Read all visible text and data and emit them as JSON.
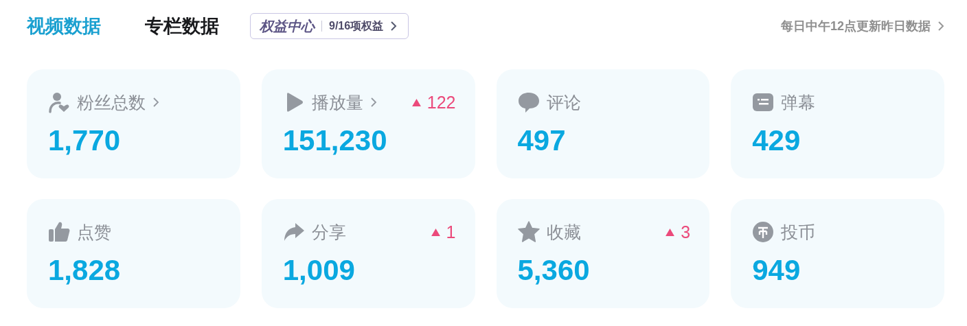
{
  "tabs": [
    {
      "label": "视频数据",
      "selected": true
    },
    {
      "label": "专栏数据",
      "selected": false
    }
  ],
  "benefits": {
    "title": "权益中心",
    "count": "9/16项权益"
  },
  "update_note": "每日中午12点更新昨日数据",
  "stats": [
    {
      "kind": "fans",
      "label": "粉丝总数",
      "link": true,
      "value": "1,770"
    },
    {
      "kind": "play",
      "label": "播放量",
      "link": true,
      "value": "151,230",
      "increase": "122"
    },
    {
      "kind": "comment",
      "label": "评论",
      "link": false,
      "value": "497"
    },
    {
      "kind": "danmaku",
      "label": "弹幕",
      "link": false,
      "value": "429"
    },
    {
      "kind": "like",
      "label": "点赞",
      "link": false,
      "value": "1,828"
    },
    {
      "kind": "share",
      "label": "分享",
      "link": false,
      "value": "1,009",
      "increase": "1"
    },
    {
      "kind": "favorite",
      "label": "收藏",
      "link": false,
      "value": "5,360",
      "increase": "3"
    },
    {
      "kind": "coin",
      "label": "投币",
      "link": false,
      "value": "949"
    }
  ]
}
